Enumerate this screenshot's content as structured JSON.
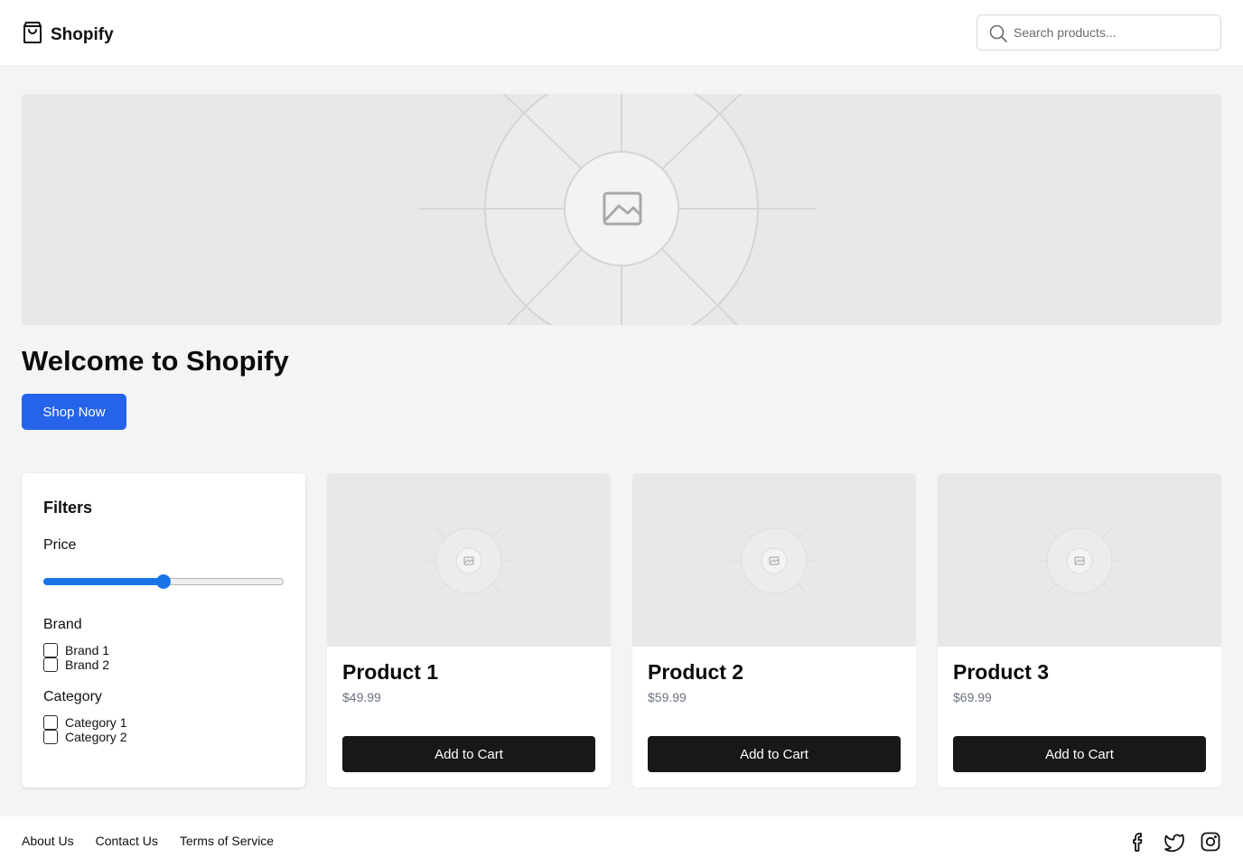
{
  "header": {
    "brand": "Shopify",
    "search_placeholder": "Search products..."
  },
  "hero": {
    "title": "Welcome to Shopify",
    "button_label": "Shop Now"
  },
  "filters": {
    "title": "Filters",
    "price_label": "Price",
    "price_value_fraction": 0.5,
    "brand_label": "Brand",
    "brands": [
      "Brand 1",
      "Brand 2"
    ],
    "category_label": "Category",
    "categories": [
      "Category 1",
      "Category 2"
    ]
  },
  "products": [
    {
      "name": "Product 1",
      "price": "$49.99",
      "button_label": "Add to Cart"
    },
    {
      "name": "Product 2",
      "price": "$59.99",
      "button_label": "Add to Cart"
    },
    {
      "name": "Product 3",
      "price": "$69.99",
      "button_label": "Add to Cart"
    }
  ],
  "footer": {
    "links": [
      "About Us",
      "Contact Us",
      "Terms of Service"
    ],
    "social_icons": [
      "facebook-icon",
      "twitter-icon",
      "instagram-icon"
    ]
  },
  "colors": {
    "primary": "#2563eb",
    "dark_button": "#18181b",
    "slider": "#1a73e8",
    "page_bg": "#f3f4f6"
  }
}
